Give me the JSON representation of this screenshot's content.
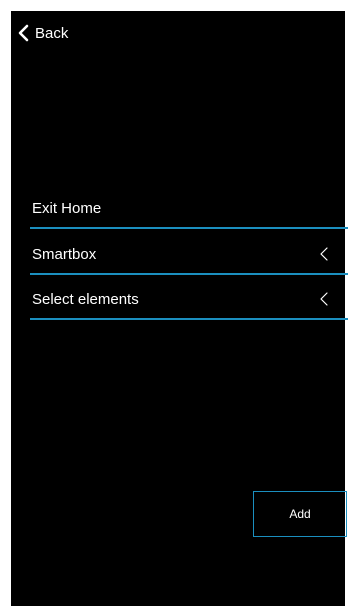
{
  "header": {
    "back_label": "Back",
    "back_icon": "chevron-left-icon"
  },
  "form": {
    "name_value": "Exit Home",
    "fields": [
      {
        "label": "Smartbox",
        "icon": "chevron-left-icon"
      },
      {
        "label": "Select elements",
        "icon": "chevron-left-icon"
      }
    ]
  },
  "footer": {
    "add_label": "Add"
  },
  "colors": {
    "background": "#000000",
    "accent": "#1b8fbf",
    "text": "#ffffff"
  }
}
